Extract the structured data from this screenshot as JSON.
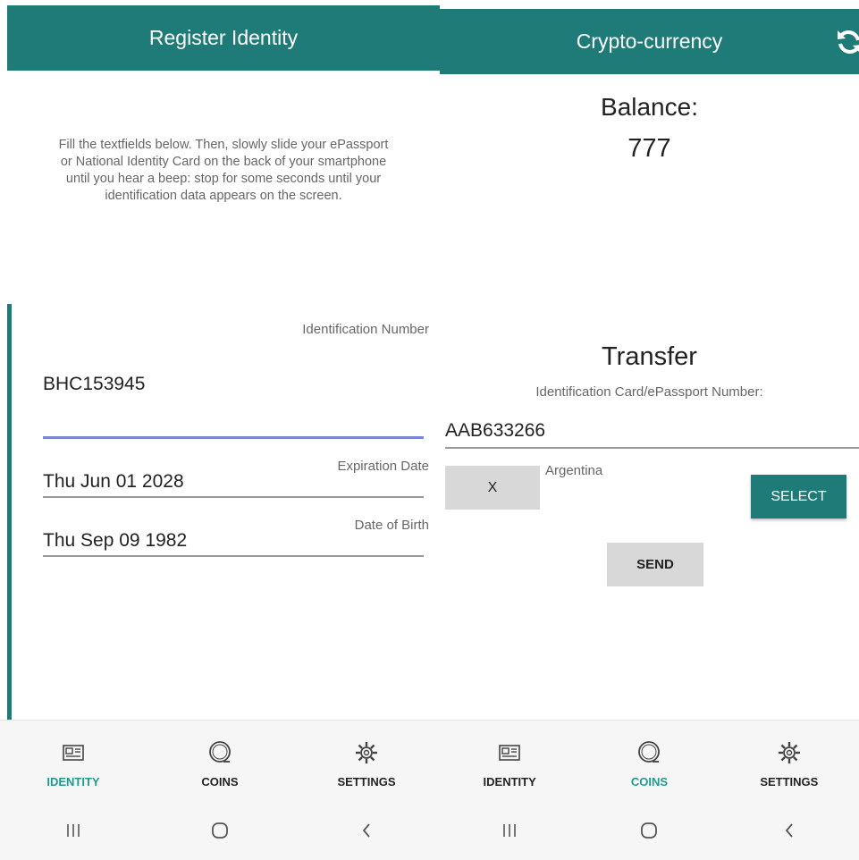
{
  "colors": {
    "primary": "#1f7b77",
    "active_nav": "#1f9a92",
    "focus_line": "#7a85d6"
  },
  "left": {
    "title": "Register Identity",
    "instructions": "Fill the textfields below. Then, slowly slide your ePassport or National Identity Card on the back of your smartphone until you hear a beep: stop for some seconds until your identification data appears on the screen.",
    "fields": [
      {
        "label": "Identification Number",
        "value": "BHC153945"
      },
      {
        "label": "Expiration Date",
        "value": "Thu Jun 01 2028"
      },
      {
        "label": "Date of Birth",
        "value": "Thu Sep 09 1982"
      }
    ],
    "nav": [
      {
        "label": "IDENTITY",
        "icon": "id-card-icon",
        "active": true
      },
      {
        "label": "COINS",
        "icon": "coin-icon",
        "active": false
      },
      {
        "label": "SETTINGS",
        "icon": "gear-icon",
        "active": false
      }
    ]
  },
  "right": {
    "title": "Crypto-currency",
    "refresh_icon": "refresh-icon",
    "balance_label": "Balance:",
    "balance_value": "777",
    "transfer_title": "Transfer",
    "transfer_subtitle": "Identification Card/ePassport Number:",
    "recipient_number": "AAB633266",
    "clear_label": "X",
    "country": "Argentina",
    "select_label": "SELECT",
    "send_label": "SEND",
    "nav": [
      {
        "label": "IDENTITY",
        "icon": "id-card-icon",
        "active": false
      },
      {
        "label": "COINS",
        "icon": "coin-icon",
        "active": true
      },
      {
        "label": "SETTINGS",
        "icon": "gear-icon",
        "active": false
      }
    ]
  },
  "system_nav": [
    "recent-apps-icon",
    "home-icon",
    "back-icon"
  ]
}
